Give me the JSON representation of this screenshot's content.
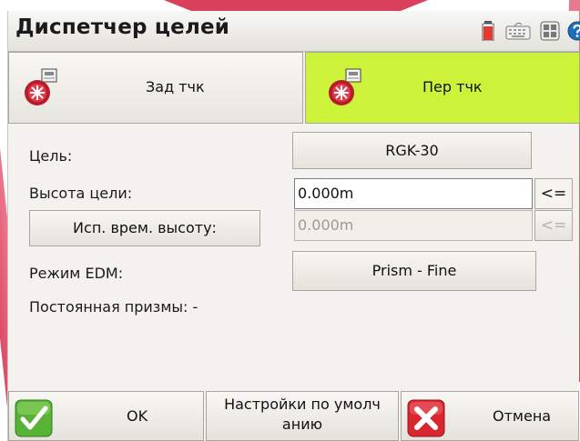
{
  "window": {
    "title": "Диспетчер целей"
  },
  "tray": {
    "battery_icon": "battery-icon",
    "keyboard_icon": "keyboard-icon",
    "sip_icon": "input-panel-icon",
    "help_icon": "help-icon"
  },
  "tabs": [
    {
      "label": "Зад тчк",
      "icon": "target-prism-icon",
      "active": false
    },
    {
      "label": "Пер тчк",
      "icon": "target-prism-icon",
      "active": true
    }
  ],
  "form": {
    "target_label": "Цель:",
    "target_value": "RGK-30",
    "height_label": "Высота цели:",
    "height_value": "0.000m",
    "height_copy_button": "<=",
    "temp_height_button": "Исп. врем. высоту:",
    "temp_height_value": "0.000m",
    "temp_height_copy_button": "<=",
    "edm_label": "Режим EDM:",
    "edm_value": "Prism - Fine",
    "prism_constant_label": "Постоянная призмы: -"
  },
  "footer": {
    "ok_label": "OK",
    "defaults_label_line1": "Настройки по умолч",
    "defaults_label_line2": "анию",
    "cancel_label": "Отмена"
  },
  "colors": {
    "active_tab": "#ccf23a",
    "accent_red": "#d62b4a",
    "ok_green": "#4aa52e",
    "cancel_red": "#d8272e"
  }
}
